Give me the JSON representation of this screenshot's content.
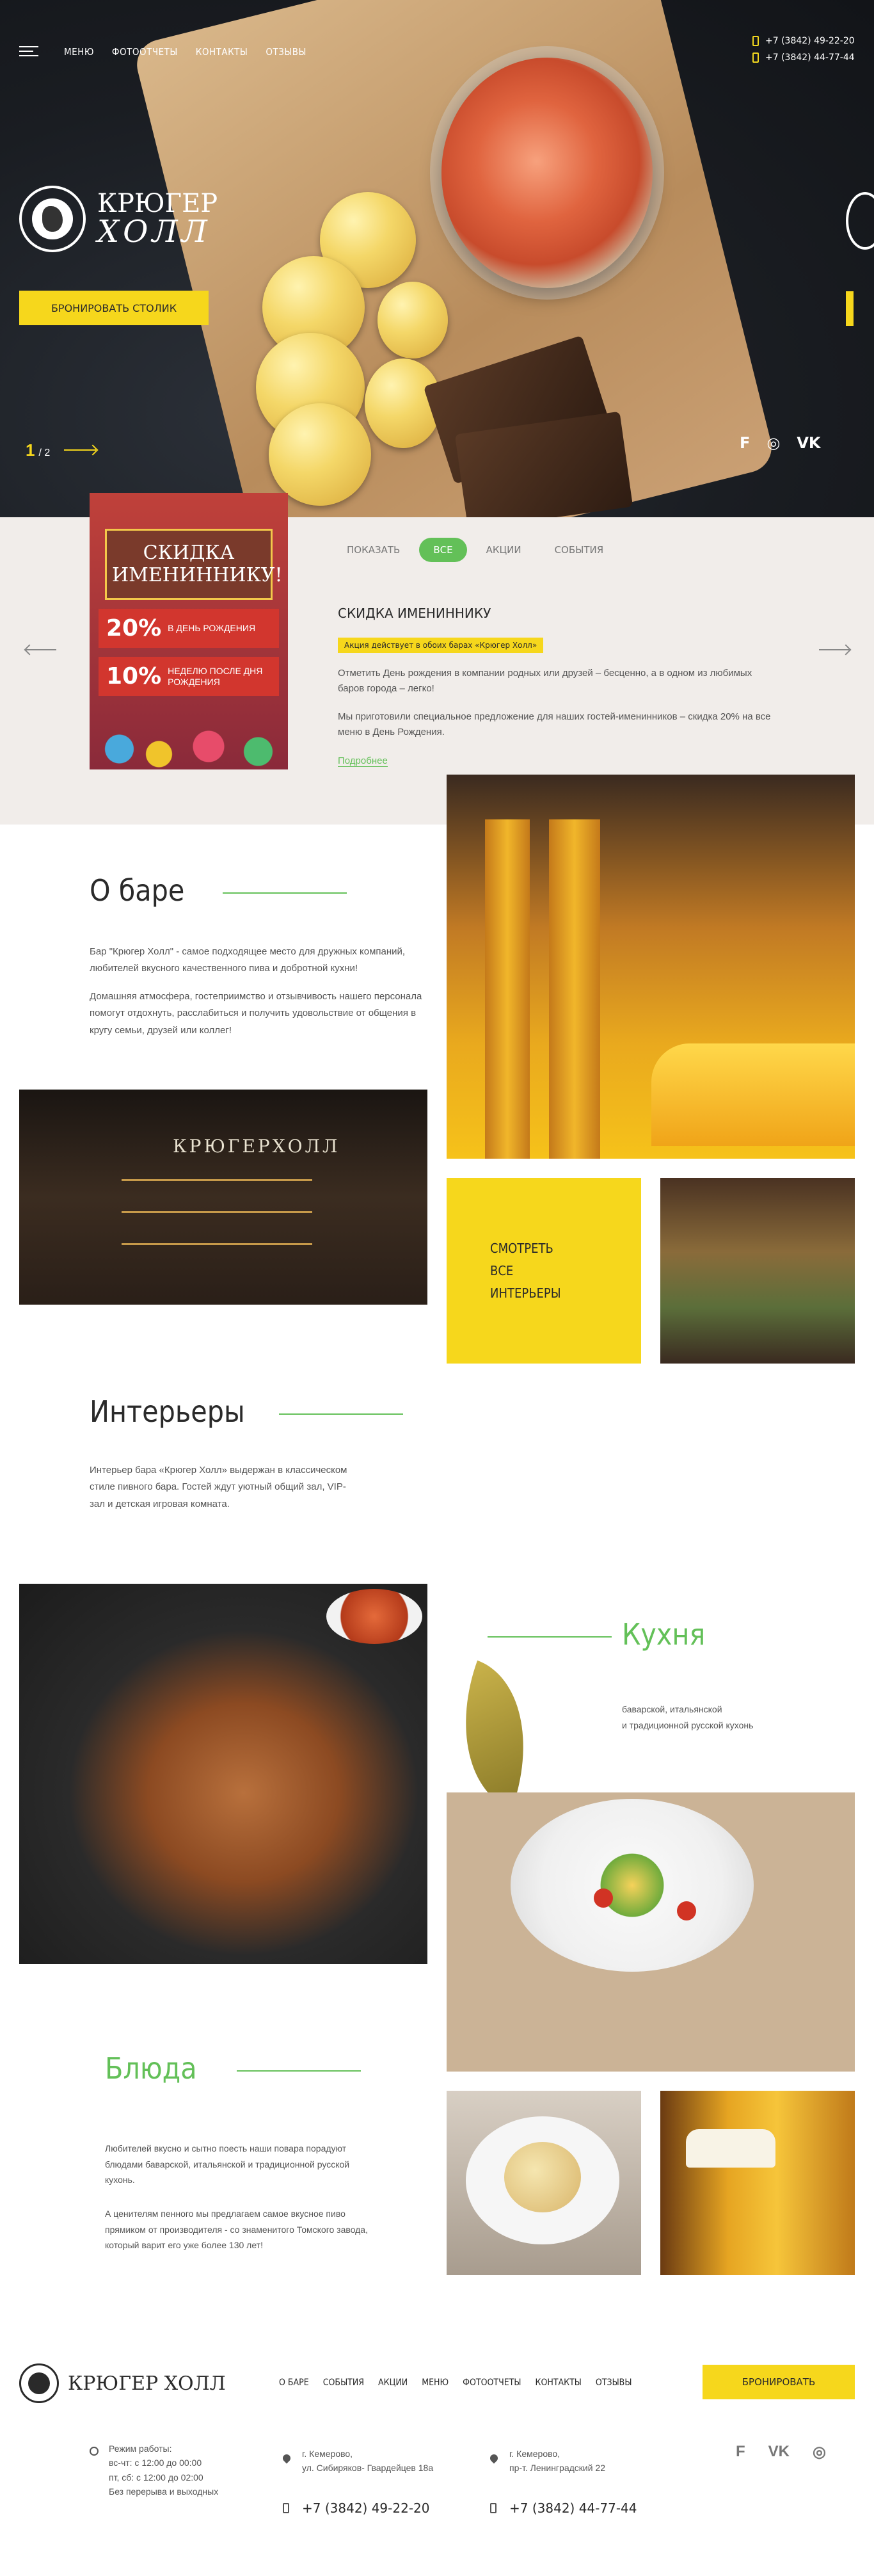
{
  "header": {
    "nav": [
      "Меню",
      "Фотоотчеты",
      "Контакты",
      "Отзывы"
    ],
    "phones": [
      "+7 (3842) 49-22-20",
      "+7 (3842) 44-77-44"
    ],
    "logo": {
      "line1": "КРЮГЕР",
      "line2": "ХОЛЛ"
    },
    "book_button": "Бронировать столик",
    "slider": {
      "current": "1",
      "total": "/ 2"
    },
    "social": [
      "foursquare-icon",
      "instagram-icon",
      "vk-icon"
    ]
  },
  "promo": {
    "tabs": [
      "Показать",
      "Все",
      "Акции",
      "События"
    ],
    "active_tab": "Все",
    "image": {
      "title": "СКИДКА ИМЕНИННИКУ!",
      "row1_big": "20%",
      "row1_small": "в день рождения",
      "row2_big": "10%",
      "row2_small": "неделю после дня рождения"
    },
    "title": "Скидка имениннику",
    "badge": "Акция действует в обоих барах «Крюгер Холл»",
    "paragraph1": "Отметить День рождения в компании родных или друзей – бесценно, а в одном из любимых баров города – легко!",
    "paragraph2": "Мы приготовили специальное предложение для наших гостей-именинников – скидка 20% на все меню в День Рождения.",
    "more": "Подробнее"
  },
  "about": {
    "title": "О баре",
    "paragraph1": "Бар \"Крюгер Холл\" - самое подходящее место для дружных компаний, любителей вкусного качественного пива и добротной кухни!",
    "paragraph2": "Домашняя атмосфера, гостеприимство и отзывчивость нашего персонала помогут отдохнуть, расслабиться и получить удовольствие от общения в кругу семьи, друзей или коллег!",
    "bar_sign": "КРЮГЕРХОЛЛ"
  },
  "interiors": {
    "cta": "Смотреть все интерьеры",
    "cta_lines": [
      "Смотреть",
      "все",
      "интерьеры"
    ],
    "title": "Интерьеры",
    "paragraph": "Интерьер бара «Крюгер Холл» выдержан в классическом стиле пивного бара. Гостей ждут уютный общий зал, VIP-зал и детская игровая комната."
  },
  "kitchen": {
    "title": "Кухня",
    "subtitle_line1": "баварской, итальянской",
    "subtitle_line2": "и традиционной русской кухонь"
  },
  "dishes": {
    "title": "Блюда",
    "paragraph1": "Любителей вкусно и сытно поесть наши повара порадуют блюдами баварской, итальянской и традиционной русской кухонь.",
    "paragraph2": "А ценителям пенного мы предлагаем самое вкусное пиво прямиком от производителя - со знаменитого Томского завода, который варит его уже более 130 лет!"
  },
  "footer": {
    "logo": "КРЮГЕР ХОЛЛ",
    "nav": [
      "О баре",
      "События",
      "Акции",
      "Меню",
      "Фотоотчеты",
      "Контакты",
      "Отзывы"
    ],
    "book_button": "Бронировать",
    "hours": [
      "Режим работы:",
      "вс-чт: с 12:00 до 00:00",
      "пт, сб: с 12:00 до 02:00",
      "Без перерыва и выходных"
    ],
    "address1": [
      "г. Кемерово,",
      "ул. Сибиряков- Гвардейцев 18а"
    ],
    "address2": [
      "г. Кемерово,",
      "пр-т. Ленинградский 22"
    ],
    "phone1": "+7 (3842) 49-22-20",
    "phone2": "+7 (3842) 44-77-44",
    "social": [
      "foursquare-icon",
      "vk-icon",
      "instagram-icon"
    ]
  },
  "colors": {
    "accent_yellow": "#f6d71c",
    "accent_green": "#63c058"
  }
}
